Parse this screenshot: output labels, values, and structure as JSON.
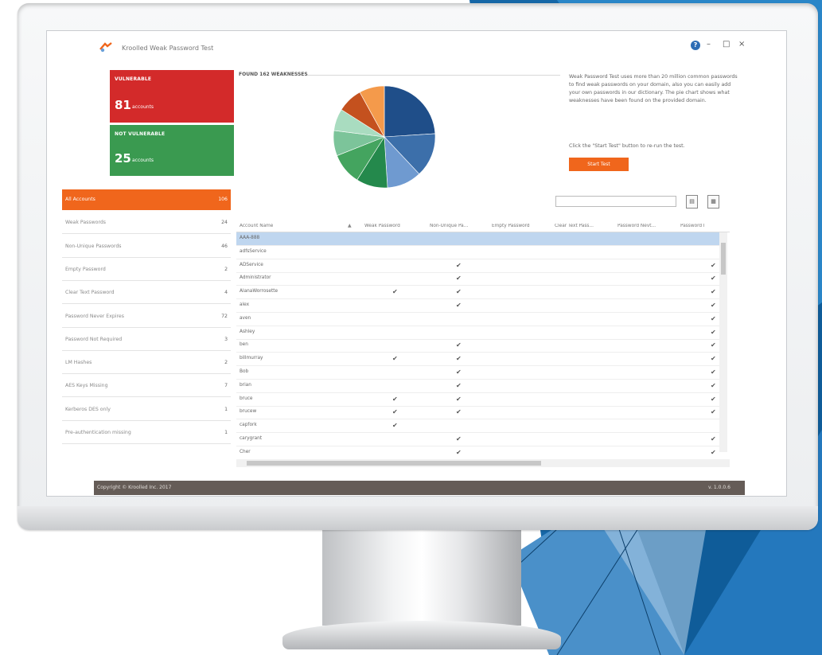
{
  "app": {
    "title": "Kroolled Weak Password Test",
    "controls": [
      "?",
      "–",
      "□",
      "×"
    ]
  },
  "summary": {
    "vulnerable": {
      "label": "VULNERABLE",
      "count": "81",
      "unit": "accounts",
      "color": "#d32a2a"
    },
    "not_vulnerable": {
      "label": "NOT VULNERABLE",
      "count": "25",
      "unit": "accounts",
      "color": "#3a9a50"
    }
  },
  "sidebar": {
    "items": [
      {
        "label": "All Accounts",
        "count": "106",
        "active": true
      },
      {
        "label": "Weak Passwords",
        "count": "24"
      },
      {
        "label": "Non-Unique Passwords",
        "count": "46"
      },
      {
        "label": "Empty Password",
        "count": "2"
      },
      {
        "label": "Clear Text Password",
        "count": "4"
      },
      {
        "label": "Password Never Expires",
        "count": "72"
      },
      {
        "label": "Password Not Required",
        "count": "3"
      },
      {
        "label": "LM Hashes",
        "count": "2"
      },
      {
        "label": "AES Keys Missing",
        "count": "7"
      },
      {
        "label": "Kerberos DES only",
        "count": "1"
      },
      {
        "label": "Pre-authentication missing",
        "count": "1"
      }
    ]
  },
  "weaknesses": {
    "title": "FOUND 162 WEAKNESSES",
    "description": "Weak Password Test uses more than 20 million common passwords to find weak passwords on your domain, also you can easily add your own passwords in our dictionary. The pie chart shows what weaknesses have been found on the provided domain.",
    "hint": "Click the \"Start Test\" button to re-run the test.",
    "start_button": "Start Test"
  },
  "pie": {
    "slices": [
      {
        "value": 24,
        "color": "#1f4e89"
      },
      {
        "value": 14,
        "color": "#3c6faa"
      },
      {
        "value": 11,
        "color": "#6f9ad0"
      },
      {
        "value": 10,
        "color": "#24894c"
      },
      {
        "value": 10,
        "color": "#44a45f"
      },
      {
        "value": 8,
        "color": "#7cc49a"
      },
      {
        "value": 7,
        "color": "#a9dcc0"
      },
      {
        "value": 8,
        "color": "#c4511e"
      },
      {
        "value": 8,
        "color": "#f49a4b"
      }
    ]
  },
  "search": {
    "placeholder": ""
  },
  "export_icons": [
    "export-pdf-icon",
    "export-csv-icon"
  ],
  "table": {
    "columns": [
      "Account Name",
      "Weak Password",
      "Non-Unique Pa...",
      "Empty Password",
      "Clear Text Pass...",
      "Password Nevt...",
      "Password I"
    ],
    "rows": [
      {
        "name": "AAA-888",
        "checks": [
          false,
          false,
          false,
          false,
          false,
          false
        ],
        "selected": true
      },
      {
        "name": "adfsService",
        "checks": [
          false,
          false,
          false,
          false,
          false,
          false
        ]
      },
      {
        "name": "ADService",
        "checks": [
          false,
          true,
          false,
          false,
          false,
          true
        ]
      },
      {
        "name": "Administrator",
        "checks": [
          false,
          true,
          false,
          false,
          false,
          true
        ]
      },
      {
        "name": "AlanaWorrosette",
        "checks": [
          true,
          true,
          false,
          false,
          false,
          true
        ]
      },
      {
        "name": "alex",
        "checks": [
          false,
          true,
          false,
          false,
          false,
          true
        ]
      },
      {
        "name": "aven",
        "checks": [
          false,
          false,
          false,
          false,
          false,
          true
        ]
      },
      {
        "name": "Ashley",
        "checks": [
          false,
          false,
          false,
          false,
          false,
          true
        ]
      },
      {
        "name": "ben",
        "checks": [
          false,
          true,
          false,
          false,
          false,
          true
        ]
      },
      {
        "name": "billmurray",
        "checks": [
          true,
          true,
          false,
          false,
          false,
          true
        ]
      },
      {
        "name": "Bob",
        "checks": [
          false,
          true,
          false,
          false,
          false,
          true
        ]
      },
      {
        "name": "brian",
        "checks": [
          false,
          true,
          false,
          false,
          false,
          true
        ]
      },
      {
        "name": "bruce",
        "checks": [
          true,
          true,
          false,
          false,
          false,
          true
        ]
      },
      {
        "name": "brucew",
        "checks": [
          true,
          true,
          false,
          false,
          false,
          true
        ]
      },
      {
        "name": "capfork",
        "checks": [
          true,
          false,
          false,
          false,
          false,
          false
        ]
      },
      {
        "name": "carygrant",
        "checks": [
          false,
          true,
          false,
          false,
          false,
          true
        ]
      },
      {
        "name": "Cher",
        "checks": [
          false,
          true,
          false,
          false,
          false,
          true
        ]
      }
    ]
  },
  "footer": {
    "copyright": "Copyright © Kroolled Inc. 2017",
    "version": "v. 1.0.0.6"
  }
}
